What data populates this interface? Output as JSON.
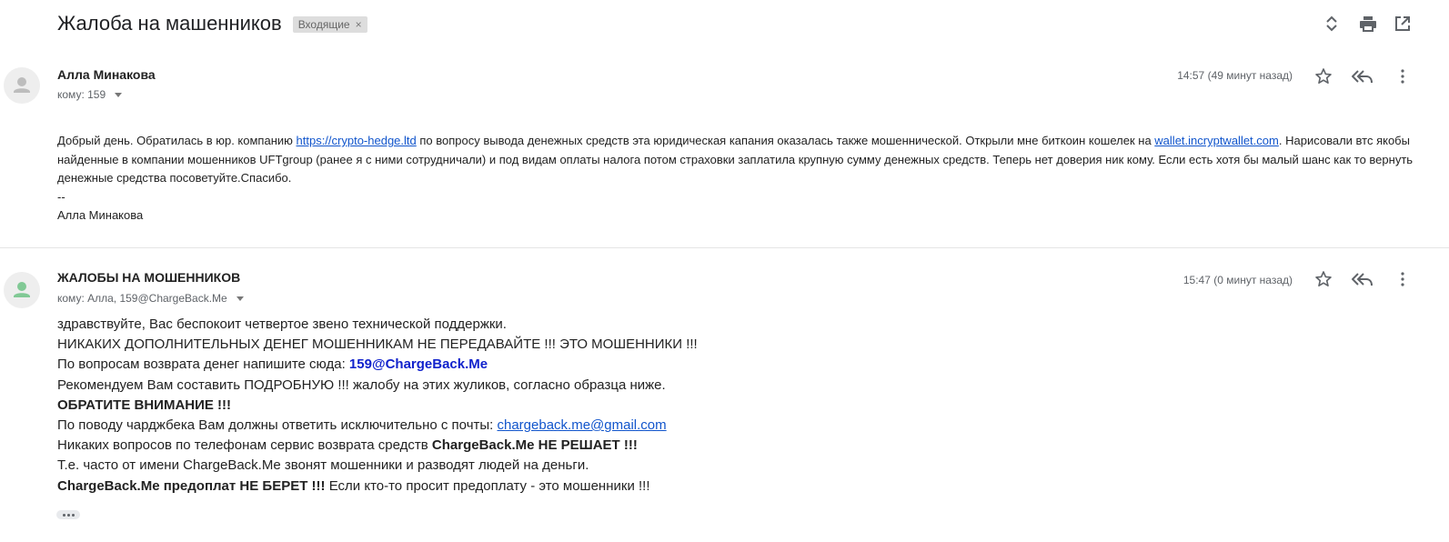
{
  "thread": {
    "subject": "Жалоба на машенников",
    "label": "Входящие",
    "label_remove": "×"
  },
  "toolbar": {
    "icons": [
      "expand-collapse-icon",
      "print-icon",
      "open-in-new-window-icon"
    ]
  },
  "messages": [
    {
      "sender": "Алла Минакова",
      "to": "кому: 159",
      "time": "14:57 (49 минут назад)",
      "body": {
        "p1_a": "Добрый день. Обратилась в юр. компанию ",
        "link1": "https://crypto-hedge.ltd",
        "p1_b": " по вопросу вывода денежных средств эта юридическая капания оказалась также мошеннической. Открыли мне биткоин кошелек на ",
        "link2": "wallet.incryptwallet.com",
        "p1_c": ".",
        "p2": "Нарисовали втс якобы найденные в  компании мошенников UFTgroup (ранее я с ними сотрудничали) и под видам оплаты налога потом страховки заплатила крупную сумму денежных средств. Теперь нет доверия ник кому. Если есть хотя бы малый шанс как то вернуть денежные средства посоветуйте.Спасибо.",
        "sig_sep": "--",
        "sig_name": "Алла Минакова"
      }
    },
    {
      "sender": "ЖАЛОБЫ НА МОШЕННИКОВ",
      "to": "кому: Алла, 159@ChargeBack.Me",
      "time": "15:47 (0 минут назад)",
      "body": {
        "l1": "здравствуйте, Вас беспокоит четвертое звено технической поддержки.",
        "l2": "НИКАКИХ ДОПОЛНИТЕЛЬНЫХ ДЕНЕГ МОШЕННИКАМ НЕ ПЕРЕДАВАЙТЕ !!! ЭТО МОШЕННИКИ !!!",
        "l3_a": "По вопросам возврата денег напишите сюда: ",
        "l3_b": "159@ChargeBack.Me",
        "l4": "Рекомендуем Вам составить ПОДРОБНУЮ !!! жалобу на этих жуликов, согласно образца ниже.",
        "l5": "ОБРАТИТЕ ВНИМАНИЕ !!!",
        "l6_a": "По поводу чарджбека Вам должны ответить исключительно с почты: ",
        "l6_b": "chargeback.me@gmail.com",
        "l7_a": "Никаких вопросов по телефонам сервис возврата средств ",
        "l7_b": "ChargeBack.Me НЕ РЕШАЕТ !!!",
        "l8": "Т.е. часто от имени ChargeBack.Me звонят мошенники и разводят людей на деньги.",
        "l9_a": "ChargeBack.Me предоплат НЕ БЕРЕТ !!!",
        "l9_b": " Если кто-то просит предоплату - это мошенники !!!"
      }
    }
  ],
  "colors": {
    "link": "#1155cc",
    "bold_link": "#1122cc",
    "avatar_grey": "#bdbdbd",
    "avatar_teal": "#81c995"
  }
}
